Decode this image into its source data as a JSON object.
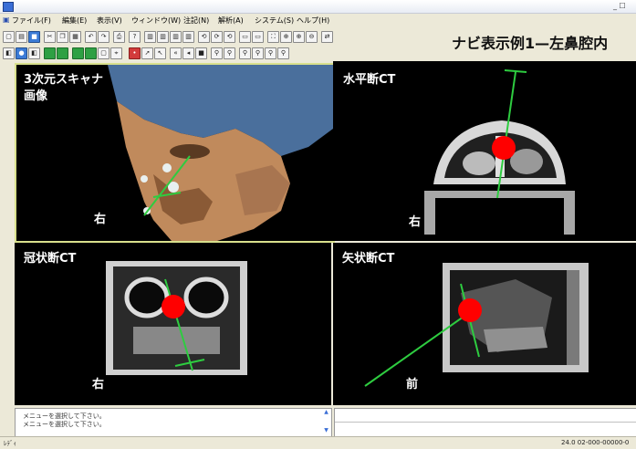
{
  "menu": [
    "ファイル(F)",
    "編集(E)",
    "表示(V)",
    "ウィンドウ(W)",
    "注記(N)",
    "解析(A)",
    "システム(S)",
    "ヘルプ(H)"
  ],
  "nav_title": "ナビ表示例1—左鼻腔内",
  "panels": {
    "scan": {
      "title_line1": "3次元スキャナ",
      "title_line2": "画像",
      "direction": "右"
    },
    "axial": {
      "title": "水平断CT",
      "direction": "右"
    },
    "coronal": {
      "title": "冠状断CT",
      "direction": "右"
    },
    "sagittal": {
      "title": "矢状断CT",
      "direction": "前"
    }
  },
  "log": [
    "メニューを選択して下さい。",
    "メニューを選択して下さい。"
  ],
  "status": {
    "left": "ﾚﾃﾞｨ",
    "right": "24.0  02-000-00000-0"
  },
  "colors": {
    "accent_green": "#2ecc40",
    "marker_red": "#ff0000",
    "active_border": "#d8e08c"
  }
}
